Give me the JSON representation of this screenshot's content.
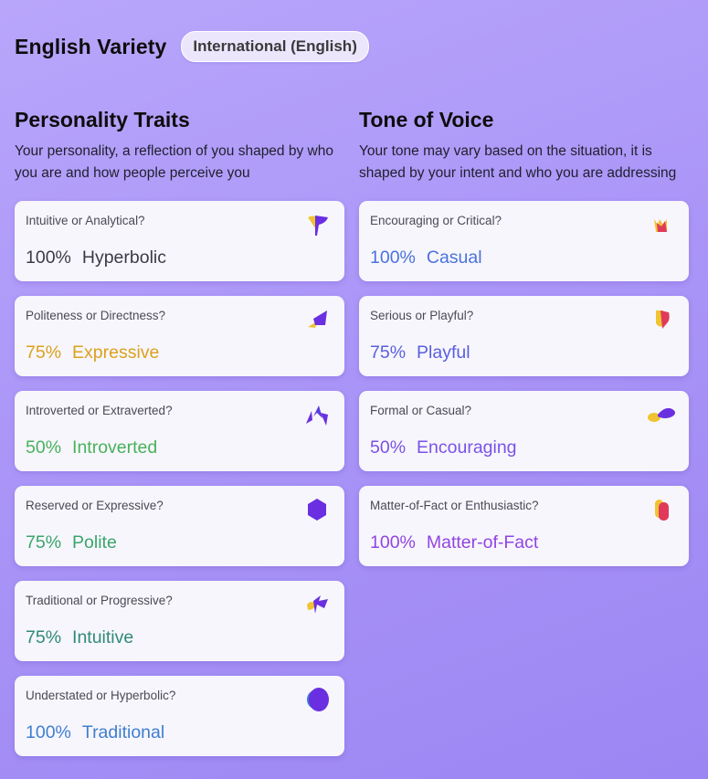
{
  "header": {
    "title": "English Variety",
    "badge": "International (English)"
  },
  "personality": {
    "title": "Personality Traits",
    "description": "Your personality, a reflection of you shaped by who you are and how people perceive you",
    "cards": [
      {
        "question": "Intuitive or Analytical?",
        "percent": "100%",
        "value": "Hyperbolic",
        "icon": "flag-icon",
        "color": "#3b3b46"
      },
      {
        "question": "Politeness or Directness?",
        "percent": "75%",
        "value": "Expressive",
        "icon": "kite-icon",
        "color": "#dca11d"
      },
      {
        "question": "Introverted or Extraverted?",
        "percent": "50%",
        "value": "Introverted",
        "icon": "zigzag-icon",
        "color": "#47b25b"
      },
      {
        "question": "Reserved or Expressive?",
        "percent": "75%",
        "value": "Polite",
        "icon": "hexagon-icon",
        "color": "#3aa56c"
      },
      {
        "question": "Traditional or Progressive?",
        "percent": "75%",
        "value": "Intuitive",
        "icon": "bow-icon",
        "color": "#2f8a78"
      },
      {
        "question": "Understated or Hyperbolic?",
        "percent": "100%",
        "value": "Traditional",
        "icon": "blob-icon",
        "color": "#3f7ecf"
      }
    ]
  },
  "tone": {
    "title": "Tone of Voice",
    "description": "Your tone may vary based on the situation, it is shaped by your intent and who you are addressing",
    "cards": [
      {
        "question": "Encouraging or Critical?",
        "percent": "100%",
        "value": "Casual",
        "icon": "crown-icon",
        "color": "#4a72dd"
      },
      {
        "question": "Serious or Playful?",
        "percent": "75%",
        "value": "Playful",
        "icon": "shield-icon",
        "color": "#5a5ee0"
      },
      {
        "question": "Formal or Casual?",
        "percent": "50%",
        "value": "Encouraging",
        "icon": "wave-icon",
        "color": "#7a52e6"
      },
      {
        "question": "Matter-of-Fact or Enthusiastic?",
        "percent": "100%",
        "value": "Matter-of-Fact",
        "icon": "pill-icon",
        "color": "#9144e3"
      }
    ]
  }
}
